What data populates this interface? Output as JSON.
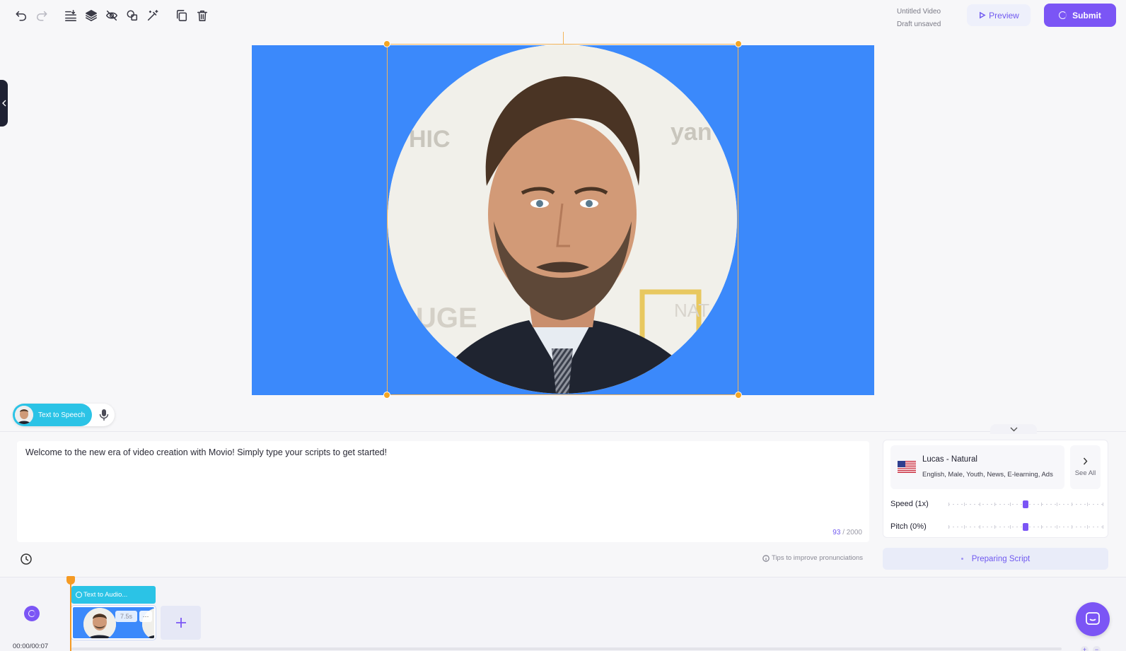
{
  "document": {
    "title": "Untitled Video",
    "save_status": "Draft unsaved"
  },
  "header": {
    "preview_label": "Preview",
    "submit_label": "Submit"
  },
  "toolbar": {
    "icons": [
      "undo-icon",
      "redo-icon",
      "align-icon",
      "layers-icon",
      "hide-icon",
      "shapes-icon",
      "magic-wand-icon",
      "duplicate-icon",
      "trash-icon"
    ]
  },
  "canvas": {
    "background_color": "#3b89fb",
    "selection_color": "#f3b45a"
  },
  "tts": {
    "mode_label": "Text to Speech"
  },
  "script": {
    "text": "Welcome to the new era of video creation with Movio! Simply type your scripts to get started!",
    "char_count": "93",
    "char_limit": "/ 2000",
    "tips_label": "Tips to improve pronunciations"
  },
  "voice": {
    "name": "Lucas - Natural",
    "tags": "English, Male, Youth, News, E-learning, Ads",
    "see_all_label": "See All",
    "speed_label": "Speed (1x)",
    "speed_value": 0.5,
    "pitch_label": "Pitch (0%)",
    "pitch_value": 0.5
  },
  "preparing_label": "Preparing Script",
  "timeline": {
    "audio_clip_label": "Text to Audio...",
    "scene_duration": "7.5s",
    "scene_more": "···",
    "time_display": "00:00/00:07",
    "zoom_in": "+",
    "zoom_out": "−"
  },
  "colors": {
    "accent": "#7b55f5",
    "tts_cyan": "#2bc3e6",
    "playhead": "#f59a23"
  }
}
